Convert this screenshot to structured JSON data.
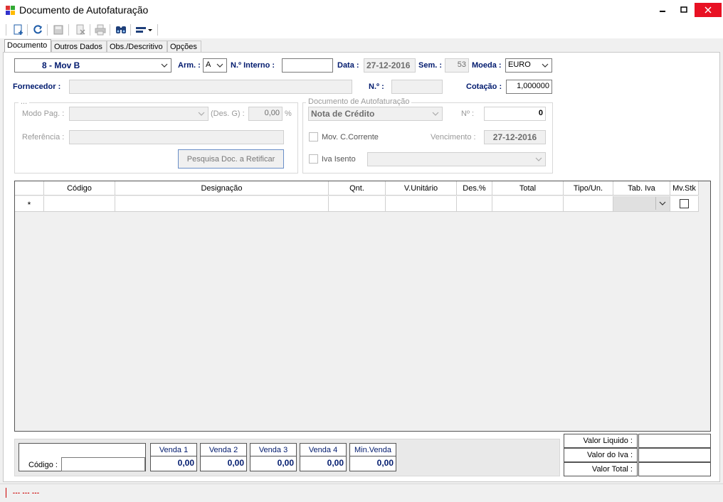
{
  "window": {
    "title": "Documento de Autofaturação",
    "controls": {
      "minimize": "—",
      "maximize": "☐",
      "close": "✕"
    },
    "close_color": "#e81123"
  },
  "toolbar": {
    "buttons": [
      "new-icon",
      "refresh-icon",
      "save-icon",
      "delete-icon",
      "print-icon",
      "find-icon",
      "layout-dropdown-icon"
    ]
  },
  "tabs": [
    {
      "label": "Documento",
      "active": true
    },
    {
      "label": "Outros Dados",
      "active": false
    },
    {
      "label": "Obs./Descritivo",
      "active": false
    },
    {
      "label": "Opções",
      "active": false
    }
  ],
  "header": {
    "serie_value": "8 - Mov B",
    "arm_label": "Arm. :",
    "arm_value": "A",
    "n_interno_label": "N.º Interno :",
    "n_interno_value": "",
    "data_label": "Data :",
    "data_value": "27-12-2016",
    "sem_label": "Sem. :",
    "sem_value": "53",
    "moeda_label": "Moeda :",
    "moeda_value": "EURO",
    "fornecedor_label": "Fornecedor :",
    "fornecedor_value": "",
    "no_label": "N.º :",
    "no_value": "",
    "cotacao_label": "Cotação :",
    "cotacao_value": "1,000000"
  },
  "left_group": {
    "title": "...",
    "modo_pag_label": "Modo Pag. :",
    "modo_pag_value": "",
    "des_g_label": "(Des. G) :",
    "des_g_value": "0,00",
    "percent": "%",
    "referencia_label": "Referência :",
    "referencia_value": "",
    "pesquisa_button": "Pesquisa Doc. a Retificar"
  },
  "right_group": {
    "title": "Documento de Autofaturação",
    "tipo_value": "Nota de Crédito",
    "n_label": "Nº :",
    "n_value": "0",
    "mov_cc_label": "Mov. C.Corrente",
    "vencimento_label": "Vencimento :",
    "vencimento_value": "27-12-2016",
    "iva_isento_label": "Iva Isento",
    "iva_isento_value": ""
  },
  "grid": {
    "columns": [
      "",
      "Código",
      "Designação",
      "Qnt.",
      "V.Unitário",
      "Des.%",
      "Total",
      "Tipo/Un.",
      "Tab. Iva",
      "Mv.Stk"
    ],
    "new_row_marker": "*"
  },
  "bottom": {
    "codigo_label": "Código :",
    "codigo_value": "",
    "sales": [
      {
        "label": "Venda 1",
        "value": "0,00"
      },
      {
        "label": "Venda 2",
        "value": "0,00"
      },
      {
        "label": "Venda 3",
        "value": "0,00"
      },
      {
        "label": "Venda 4",
        "value": "0,00"
      },
      {
        "label": "Min.Venda",
        "value": "0,00"
      }
    ]
  },
  "totals": {
    "valor_liquido_label": "Valor Liquido :",
    "valor_liquido_value": "",
    "valor_iva_label": "Valor do Iva :",
    "valor_iva_value": "",
    "valor_total_label": "Valor Total :",
    "valor_total_value": ""
  },
  "status": {
    "text": "--- --- ---",
    "color": "#cc0000"
  }
}
